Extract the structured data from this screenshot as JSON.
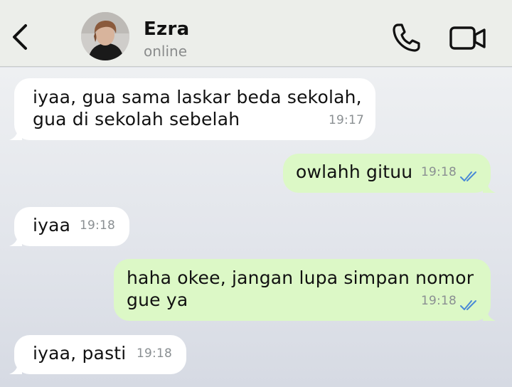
{
  "header": {
    "contact_name": "Ezra",
    "status": "online",
    "icons": {
      "back": "chevron-left-icon",
      "call": "phone-icon",
      "video": "video-camera-icon"
    }
  },
  "colors": {
    "header_bg": "#eceeea",
    "incoming_bubble": "#ffffff",
    "outgoing_bubble": "#dcf8c6",
    "read_check": "#4a8ad6"
  },
  "messages": [
    {
      "direction": "in",
      "text": "iyaa, gua sama laskar beda sekolah,\ngua di sekolah sebelah",
      "time": "19:17"
    },
    {
      "direction": "out",
      "text": "owlahh gituu",
      "time": "19:18",
      "read": true
    },
    {
      "direction": "in",
      "text": "iyaa",
      "time": "19:18"
    },
    {
      "direction": "out",
      "text": "haha okee, jangan lupa simpan nomor\ngue ya",
      "time": "19:18",
      "read": true
    },
    {
      "direction": "in",
      "text": "iyaa, pasti",
      "time": "19:18"
    }
  ]
}
